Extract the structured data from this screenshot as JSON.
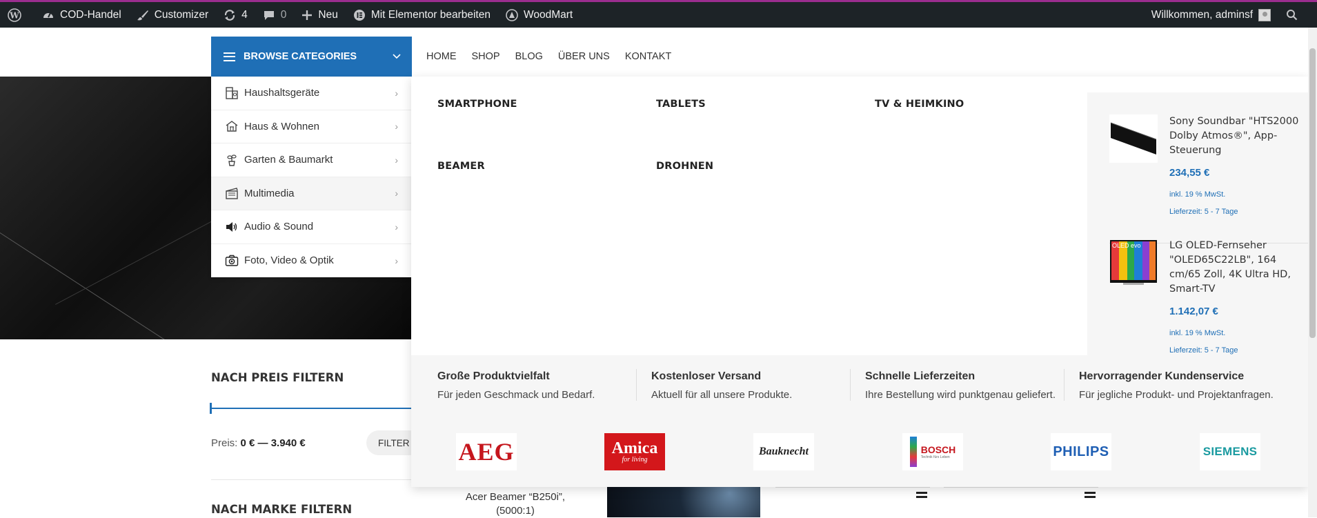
{
  "admin_bar": {
    "site_name": "COD-Handel",
    "customizer": "Customizer",
    "updates_count": "4",
    "comments_count": "0",
    "new_label": "Neu",
    "elementor": "Mit Elementor bearbeiten",
    "theme": "WoodMart",
    "welcome": "Willkommen, adminsf"
  },
  "browse_categories": "BROWSE CATEGORIES",
  "main_nav": [
    "HOME",
    "SHOP",
    "BLOG",
    "ÜBER UNS",
    "KONTAKT"
  ],
  "categories": [
    {
      "label": "Haushaltsgeräte",
      "icon": "appliance-icon"
    },
    {
      "label": "Haus & Wohnen",
      "icon": "house-icon"
    },
    {
      "label": "Garten & Baumarkt",
      "icon": "plant-icon"
    },
    {
      "label": "Multimedia",
      "icon": "clapperboard-icon"
    },
    {
      "label": "Audio & Sound",
      "icon": "speaker-icon"
    },
    {
      "label": "Foto, Video & Optik",
      "icon": "camera-icon"
    }
  ],
  "mega_subcategories": [
    "SMARTPHONE",
    "TABLETS",
    "TV & HEIMKINO",
    "BEAMER",
    "DROHNEN"
  ],
  "products": [
    {
      "name": "Sony Soundbar \"HTS2000 Dolby Atmos®\", App-Steuerung",
      "price": "234,55 €",
      "tax": "inkl. 19 % MwSt.",
      "delivery": "Lieferzeit: 5 - 7 Tage"
    },
    {
      "name": "LG OLED-Fernseher \"OLED65C22LB\", 164 cm/65 Zoll, 4K Ultra HD, Smart-TV",
      "price": "1.142,07 €",
      "tax": "inkl. 19 % MwSt.",
      "delivery": "Lieferzeit: 5 - 7 Tage",
      "image_badge": "OLED evo"
    }
  ],
  "features": [
    {
      "title": "Große Produktvielfalt",
      "subtitle": "Für jeden Geschmack und Bedarf."
    },
    {
      "title": "Kostenloser Versand",
      "subtitle": "Aktuell für all unsere Produkte."
    },
    {
      "title": "Schnelle Lieferzeiten",
      "subtitle": "Ihre Bestellung wird punktgenau geliefert."
    },
    {
      "title": "Hervorragender Kundenservice",
      "subtitle": "Für jegliche Produkt- und Projektanfragen."
    }
  ],
  "brands": [
    "AEG",
    "Amica",
    "Bauknecht",
    "BOSCH",
    "PHILIPS",
    "SIEMENS"
  ],
  "brand_extra": {
    "amica_tagline": "for living",
    "bosch_tagline": "Technik fürs Leben"
  },
  "sidebar": {
    "price_filter_title": "NACH PREIS FILTERN",
    "price_label": "Preis:",
    "price_range": "0 € — 3.940 €",
    "filter_button": "FILTER",
    "brand_filter_title": "NACH MARKE FILTERN"
  },
  "product_teaser": "Acer Beamer “B250i”, (5000:1)",
  "colors": {
    "accent": "#1f6fb6",
    "admin_bar": "#1d2327",
    "top_line": "#9b2d8f"
  }
}
